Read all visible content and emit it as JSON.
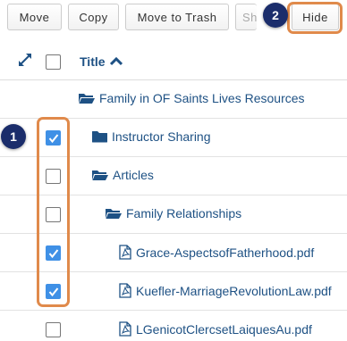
{
  "toolbar": {
    "move_label": "Move",
    "copy_label": "Copy",
    "trash_label": "Move to Trash",
    "show_label": "Sh",
    "hide_label": "Hide"
  },
  "header": {
    "expand_icon": "expand-arrows-icon",
    "title_label": "Title",
    "sort_icon": "chevron-up-icon"
  },
  "rows": [
    {
      "label": "Family in OF Saints Lives Resources",
      "type": "folder-open",
      "checkbox": false,
      "checked": false
    },
    {
      "label": "Instructor Sharing",
      "type": "folder",
      "checkbox": true,
      "checked": true
    },
    {
      "label": "Articles",
      "type": "folder-open",
      "checkbox": true,
      "checked": false
    },
    {
      "label": "Family Relationships",
      "type": "folder-open",
      "checkbox": true,
      "checked": false
    },
    {
      "label": "Grace-AspectsofFatherhood.pdf",
      "type": "pdf",
      "checkbox": true,
      "checked": true
    },
    {
      "label": "Kuefler-MarriageRevolutionLaw.pdf",
      "type": "pdf",
      "checkbox": true,
      "checked": true
    },
    {
      "label": "LGenicotClercsetLaiquesAu.pdf",
      "type": "pdf",
      "checkbox": true,
      "checked": false
    }
  ],
  "annotations": {
    "step1": "1",
    "step2": "2"
  },
  "colors": {
    "link": "#1e5184",
    "checkbox_checked": "#3f90e6",
    "highlight": "#e08a4b",
    "badge": "#1b2d6b"
  }
}
